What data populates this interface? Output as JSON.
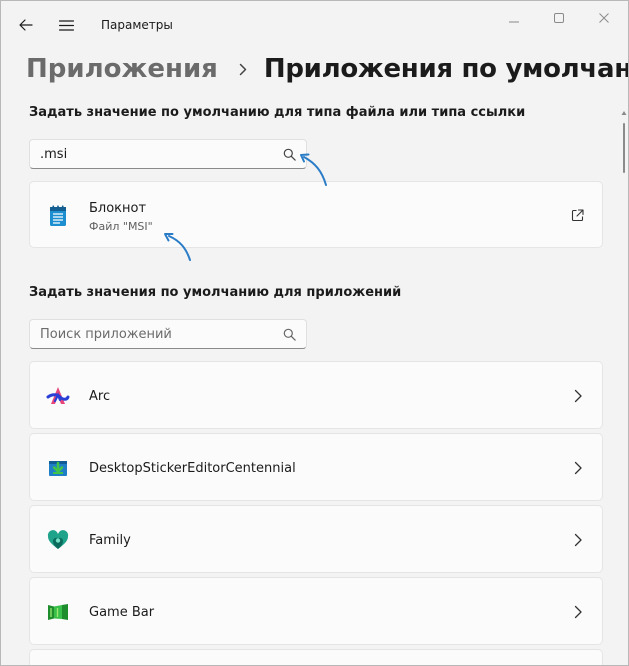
{
  "window": {
    "title": "Параметры"
  },
  "breadcrumb": {
    "parent": "Приложения",
    "current": "Приложения по умолчанию"
  },
  "file_type_section": {
    "label": "Задать значение по умолчанию для типа файла или типа ссылки",
    "search_value": ".msi",
    "result": {
      "name": "Блокнот",
      "subtitle": "Файл \"MSI\""
    }
  },
  "apps_section": {
    "label": "Задать значения по умолчанию для приложений",
    "search_placeholder": "Поиск приложений",
    "apps": [
      {
        "name": "Arc"
      },
      {
        "name": "DesktopStickerEditorCentennial"
      },
      {
        "name": "Family"
      },
      {
        "name": "Game Bar"
      }
    ]
  },
  "colors": {
    "accent": "#0067c0",
    "annotation_arrow": "#2a7cc7"
  }
}
